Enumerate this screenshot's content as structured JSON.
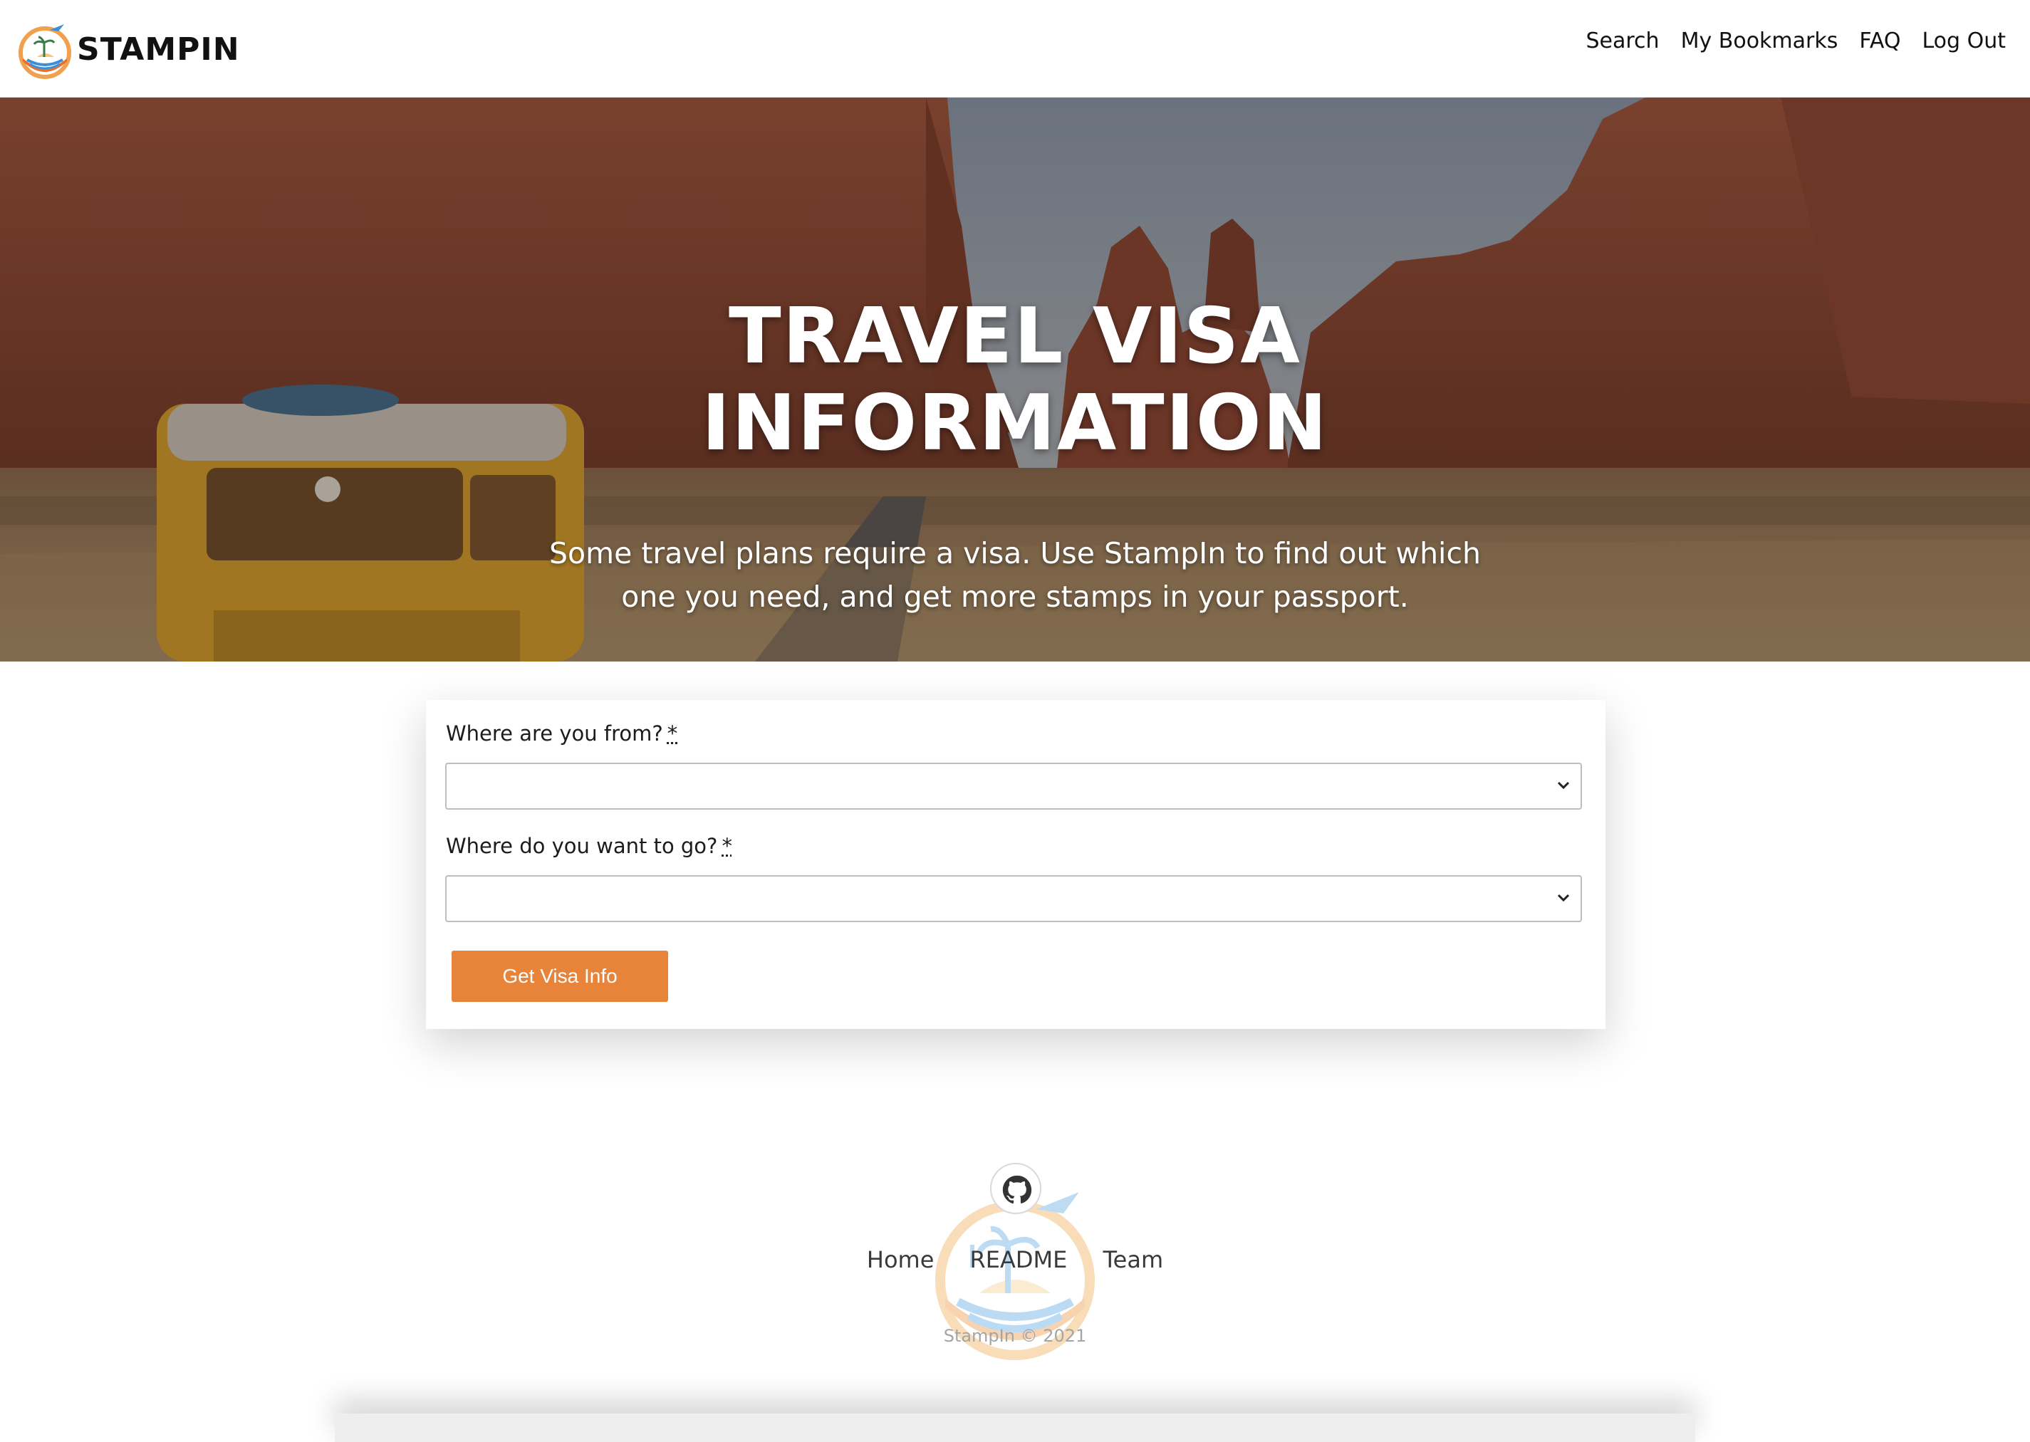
{
  "header": {
    "brand_name": "STAMPIN",
    "nav": [
      "Search",
      "My Bookmarks",
      "FAQ",
      "Log Out"
    ]
  },
  "hero": {
    "title_line1": "TRAVEL VISA",
    "title_line2": "INFORMATION",
    "subtitle": "Some travel plans require a visa. Use StampIn to find out which one you need, and get more stamps in your passport."
  },
  "form": {
    "from_label": "Where are you from?",
    "to_label": "Where do you want to go?",
    "required_mark": "*",
    "from_value": "",
    "to_value": "",
    "submit_label": "Get Visa Info"
  },
  "footer": {
    "links": [
      "Home",
      "README",
      "Team"
    ],
    "copyright": "StampIn © 2021"
  },
  "colors": {
    "accent": "#e8843a",
    "text": "#1c1c1c"
  },
  "icons": {
    "brand": "stampin-logo-icon",
    "select": "chevron-down-icon",
    "footer": "github-icon"
  }
}
